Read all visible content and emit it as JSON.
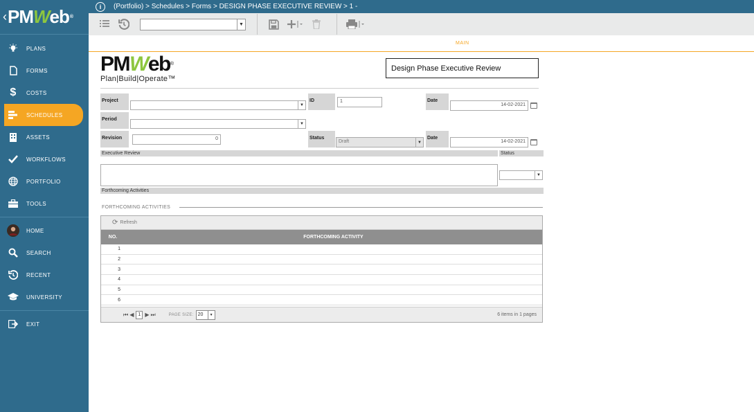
{
  "brand": {
    "logo_main": "PM",
    "logo_w": "W",
    "logo_end": "eb",
    "registered": "®"
  },
  "sidebar": {
    "items": [
      {
        "label": "PLANS",
        "icon": "lightbulb-icon"
      },
      {
        "label": "FORMS",
        "icon": "document-icon"
      },
      {
        "label": "COSTS",
        "icon": "dollar-icon"
      },
      {
        "label": "SCHEDULES",
        "icon": "schedule-icon",
        "active": true
      },
      {
        "label": "ASSETS",
        "icon": "building-icon"
      },
      {
        "label": "WORKFLOWS",
        "icon": "checkmark-icon"
      },
      {
        "label": "PORTFOLIO",
        "icon": "globe-icon"
      },
      {
        "label": "TOOLS",
        "icon": "briefcase-icon"
      }
    ],
    "items2": [
      {
        "label": "HOME",
        "icon": "avatar"
      },
      {
        "label": "SEARCH",
        "icon": "search-icon"
      },
      {
        "label": "RECENT",
        "icon": "history-icon"
      },
      {
        "label": "UNIVERSITY",
        "icon": "graduation-cap-icon"
      }
    ],
    "exit": {
      "label": "EXIT",
      "icon": "exit-icon"
    }
  },
  "breadcrumb": "(Portfolio) > Schedules > Forms > DESIGN PHASE EXECUTIVE REVIEW > 1 -",
  "toolbar": {
    "selector_value": ""
  },
  "tabs": {
    "main": "MAIN"
  },
  "form": {
    "logo_text_1": "PM",
    "logo_w": "W",
    "logo_text_2": "eb",
    "logo_registered": "®",
    "tagline": "Plan|Build|Operate™",
    "title": "Design Phase Executive Review",
    "project_label": "Project",
    "project_value": "",
    "id_label": "ID",
    "id_value": "1",
    "date_label": "Date",
    "date_value": "14-02-2021",
    "period_label": "Period",
    "period_value": "",
    "revision_label": "Revision",
    "revision_value": "0",
    "status_label": "Status",
    "status_value": "Draft",
    "date2_label": "Date",
    "date2_value": "14-02-2021",
    "exec_review_label": "Executive Review",
    "exec_status_label": "Status",
    "forthcoming_label": "Forthcoming Activities"
  },
  "grid": {
    "title": "FORTHCOMING ACTIVITIES",
    "refresh_label": "Refresh",
    "columns": [
      "NO.",
      "FORTHCOMING ACTIVITY"
    ],
    "rows": [
      {
        "no": "1",
        "activity": ""
      },
      {
        "no": "2",
        "activity": ""
      },
      {
        "no": "3",
        "activity": ""
      },
      {
        "no": "4",
        "activity": ""
      },
      {
        "no": "5",
        "activity": ""
      },
      {
        "no": "6",
        "activity": ""
      }
    ],
    "page": "1",
    "page_size_label": "PAGE SIZE:",
    "page_size": "20",
    "summary": "6 items in 1 pages"
  }
}
